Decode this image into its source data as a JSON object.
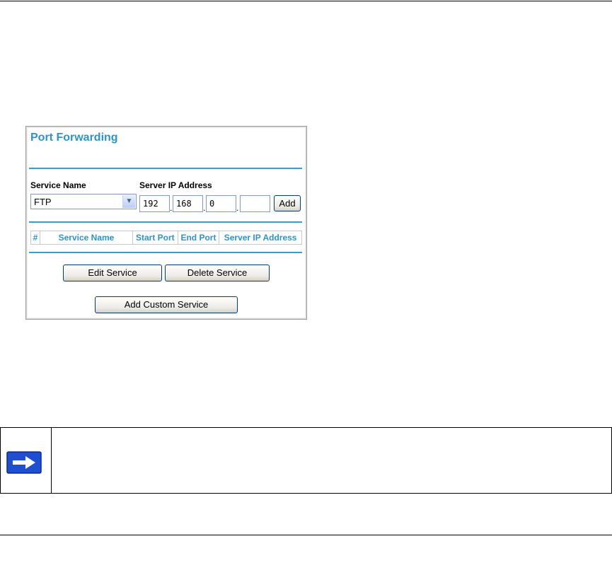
{
  "panel": {
    "title": "Port Forwarding",
    "service_name_label": "Service Name",
    "server_ip_label": "Server IP Address",
    "service_select_value": "FTP",
    "ip_octets": [
      "192",
      "168",
      "0",
      ""
    ],
    "add_button": "Add",
    "table_headers": [
      "#",
      "Service Name",
      "Start Port",
      "End Port",
      "Server IP Address"
    ],
    "edit_service_button": "Edit Service",
    "delete_service_button": "Delete Service",
    "add_custom_service_button": "Add Custom Service"
  },
  "note": {
    "icon": "arrow-right-icon",
    "text": ""
  },
  "colors": {
    "accent": "#2f93c4",
    "rule": "#3a9ccc",
    "note_icon": "#1f4fd1"
  }
}
